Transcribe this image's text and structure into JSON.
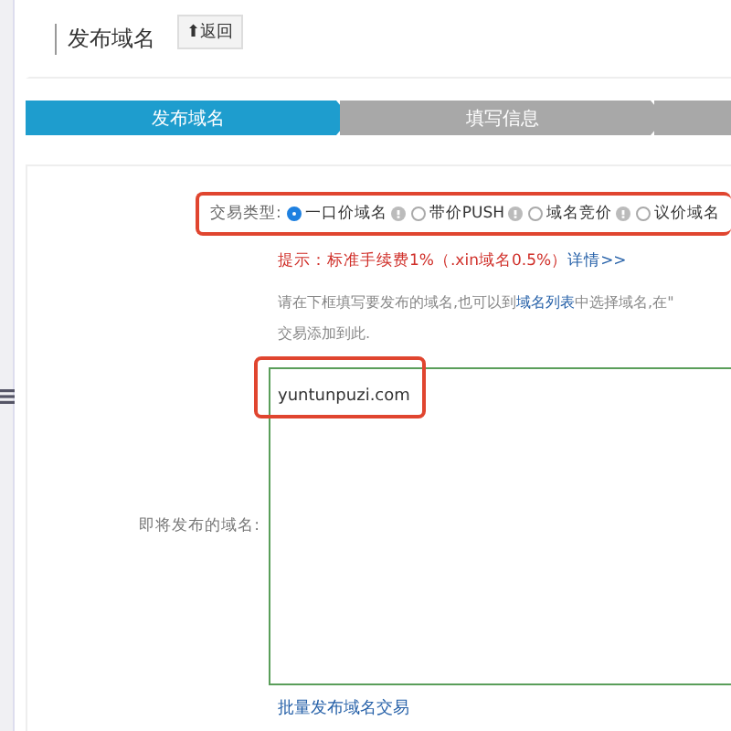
{
  "page_title": "发布域名",
  "back_button": {
    "icon": "⬆",
    "label": "返回"
  },
  "steps": [
    {
      "label": "发布域名",
      "selected": true
    },
    {
      "label": "填写信息",
      "selected": false
    },
    {
      "selected": false
    }
  ],
  "trade_type": {
    "label": "交易类型:",
    "options": [
      {
        "label": "一口价域名",
        "selected": true
      },
      {
        "label": "带价PUSH",
        "selected": false
      },
      {
        "label": "域名竞价",
        "selected": false
      },
      {
        "label": "议价域名",
        "selected": false
      }
    ]
  },
  "tip": {
    "text": "提示：标准手续费1%（.xin域名0.5%）",
    "link": "详情>>"
  },
  "instructions": {
    "before": "请在下框填写要发布的域名,也可以到",
    "link": "域名列表",
    "after": "中选择域名,在\"",
    "line_2": "交易添加到此."
  },
  "domain_field": {
    "label": "即将发布的域名:",
    "value": "yuntunpuzi.com"
  },
  "bulk_link": "批量发布域名交易"
}
